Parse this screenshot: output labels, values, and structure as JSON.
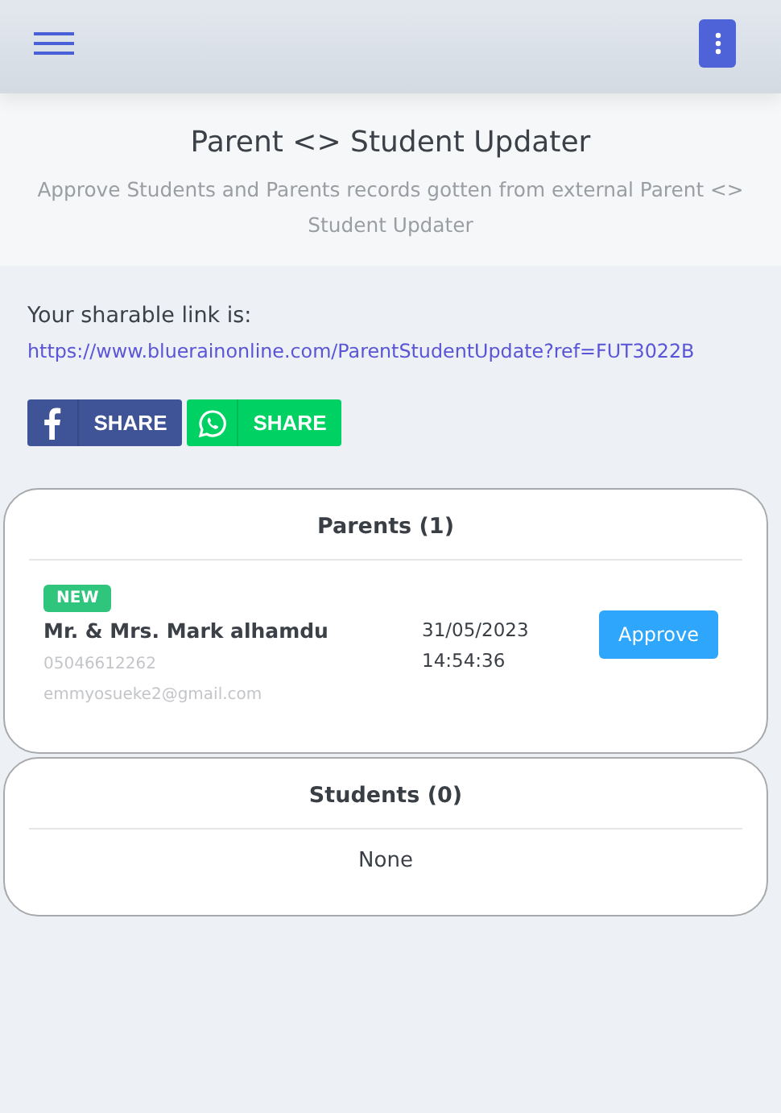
{
  "header": {
    "title": "Parent <> Student Updater",
    "subtitle": "Approve Students and Parents records gotten from external Parent <> Student Updater"
  },
  "share": {
    "label": "Your sharable link is:",
    "link": "https://www.bluerainonline.com/ParentStudentUpdate?ref=FUT3022B",
    "buttons": [
      {
        "kind": "facebook",
        "label": "SHARE"
      },
      {
        "kind": "whatsapp",
        "label": "SHARE"
      }
    ]
  },
  "sections": [
    {
      "title": "Parents (1)",
      "records": [
        {
          "badge": "NEW",
          "name": "Mr. & Mrs. Mark alhamdu",
          "phone": "05046612262",
          "email": "emmyosueke2@gmail.com",
          "date": "31/05/2023",
          "time": "14:54:36",
          "action": "Approve"
        }
      ]
    },
    {
      "title": "Students (0)",
      "empty": "None"
    }
  ]
}
